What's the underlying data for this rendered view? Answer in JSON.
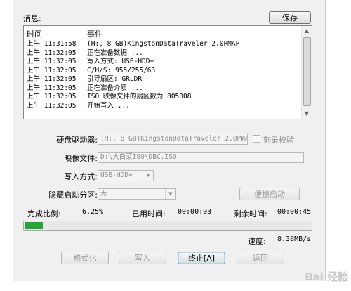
{
  "log": {
    "label": "消息:",
    "save_button": "保存",
    "columns": {
      "time": "时间",
      "event": "事件"
    },
    "rows": [
      {
        "time": "上午 11:31:58",
        "event": "(H:, 8 GB)KingstonDataTraveler 2.0PMAP"
      },
      {
        "time": "上午 11:32:05",
        "event": "正在准备数据 ..."
      },
      {
        "time": "上午 11:32:05",
        "event": "写入方式: USB-HDD+"
      },
      {
        "time": "上午 11:32:05",
        "event": "C/H/S: 955/255/63"
      },
      {
        "time": "上午 11:32:05",
        "event": "引导扇区: GRLDR"
      },
      {
        "time": "上午 11:32:05",
        "event": "正在准备介质 ..."
      },
      {
        "time": "上午 11:32:05",
        "event": "ISO 映像文件的扇区数为 805008"
      },
      {
        "time": "上午 11:32:05",
        "event": "开始写入 ..."
      }
    ],
    "scroll_up_icon": "triangle-up",
    "scroll_down_icon": "triangle-down"
  },
  "form": {
    "drive_label": "硬盘驱动器:",
    "drive_value": "(H:, 8 GB)KingstonDataTraveler 2.0PMAP",
    "verify_label": "刻录校验",
    "image_label": "映像文件:",
    "image_value": "D:\\大白菜ISO\\DBC.ISO",
    "write_mode_label": "写入方式:",
    "write_mode_value": "USB-HDD+",
    "hidden_partition_label": "隐藏启动分区:",
    "hidden_partition_value": "无",
    "quick_boot_button": "便捷启动"
  },
  "status": {
    "complete_label": "完成比例:",
    "complete_value": "6.25%",
    "progress_fraction": 0.0625,
    "elapsed_label": "已用时间:",
    "elapsed_value": "00:00:03",
    "remaining_label": "剩余时间:",
    "remaining_value": "00:00:45",
    "speed_label": "速度:",
    "speed_value": "8.38MB/s"
  },
  "buttons": {
    "format": "格式化",
    "write": "写入",
    "stop": "终止[A]",
    "back": "返回"
  },
  "watermark": "Bai 经验",
  "colors": {
    "progress": "#25a535"
  }
}
